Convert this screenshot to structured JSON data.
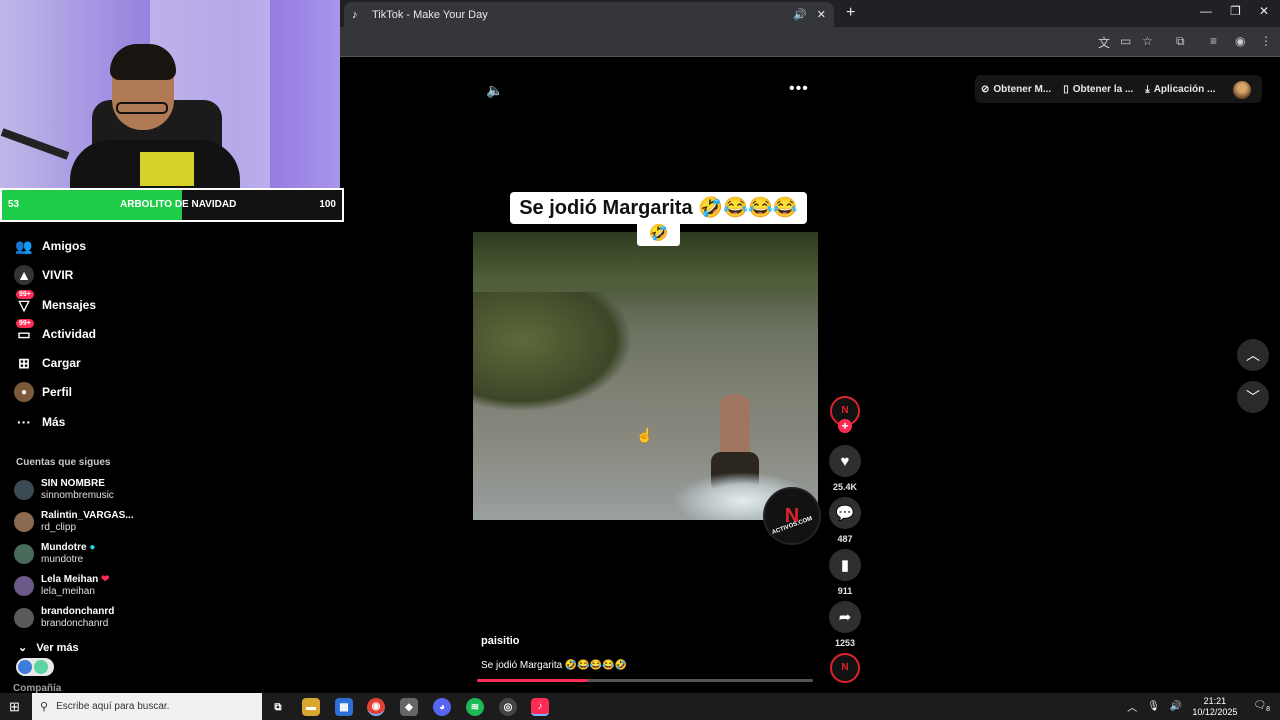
{
  "browser": {
    "tab_title": "TikTok - Make Your Day"
  },
  "webcam_overlay": {
    "goal": {
      "current": "53",
      "label": "ARBOLITO DE NAVIDAD",
      "target": "100",
      "progress_fraction": 0.53
    }
  },
  "header": {
    "actions": [
      {
        "label": "Obtener M...",
        "icon": "coin-icon"
      },
      {
        "label": "Obtener la ...",
        "icon": "phone-icon"
      },
      {
        "label": "Aplicación ...",
        "icon": "download-icon"
      }
    ]
  },
  "sidebar": {
    "items": [
      {
        "label": "Amigos",
        "icon": "friends-icon"
      },
      {
        "label": "VIVIR",
        "icon": "live-icon"
      },
      {
        "label": "Mensajes",
        "icon": "messages-icon",
        "badge": "99+"
      },
      {
        "label": "Actividad",
        "icon": "activity-icon",
        "badge": "99+"
      },
      {
        "label": "Cargar",
        "icon": "upload-icon"
      },
      {
        "label": "Perfil",
        "icon": "profile-icon"
      },
      {
        "label": "Más",
        "icon": "more-icon"
      }
    ],
    "following_title": "Cuentas que sigues",
    "following": [
      {
        "name": "SIN NOMBRE",
        "username": "sinnombremusic"
      },
      {
        "name": "Ralintin_VARGAS...",
        "username": "rd_clipp"
      },
      {
        "name": "Mundotre",
        "username": "mundotre"
      },
      {
        "name": "Lela Meihan",
        "username": "lela_meihan"
      },
      {
        "name": "brandonchanrd",
        "username": "brandonchanrd"
      }
    ],
    "see_more": "Ver más",
    "company": "Compañía"
  },
  "video": {
    "caption_line1": "Se jodió Margarita 🤣😂😂😂",
    "caption_line2": "🤣",
    "watermark": "ACTIVOS.COM",
    "author": "paisitio",
    "description": "Se jodió Margarita 🤣😂😂😂🤣",
    "progress_fraction": 0.33
  },
  "actions": {
    "likes": "25.4K",
    "comments": "487",
    "saves": "911",
    "shares": "1253"
  },
  "taskbar": {
    "search_placeholder": "Escribe aquí para buscar.",
    "time": "21:21",
    "date": "10/12/2025",
    "notifications": "8"
  },
  "colors": {
    "accent": "#fe2c55",
    "goal_green": "#1fcc48",
    "brand_red": "#e0222a"
  }
}
